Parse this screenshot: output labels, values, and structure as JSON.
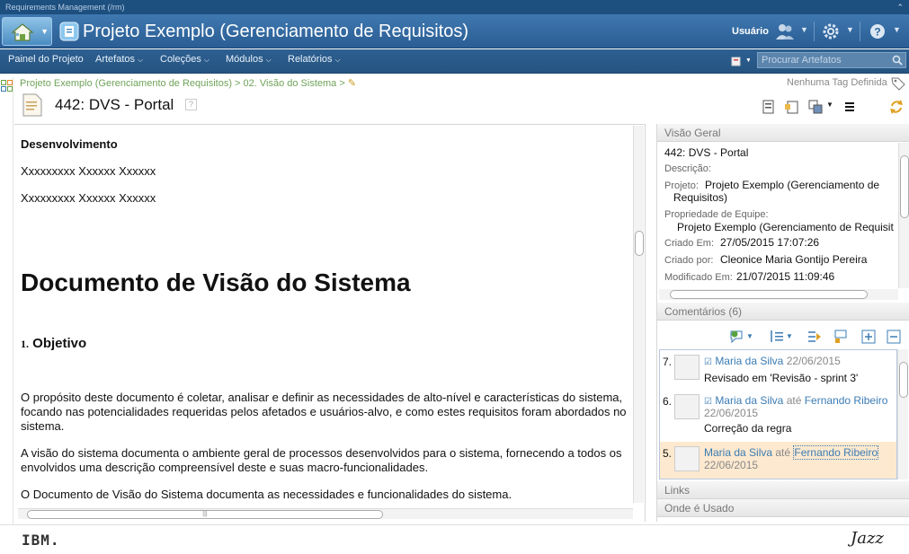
{
  "app": {
    "window_title": "Requirements Management (/rm)",
    "project_title": "Projeto Exemplo (Gerenciamento de Requisitos)",
    "user_label": "Usuário"
  },
  "nav": {
    "items": [
      "Painel do Projeto",
      "Artefatos",
      "Coleções",
      "Módulos",
      "Relatórios"
    ],
    "search_placeholder": "Procurar Artefatos"
  },
  "breadcrumb": {
    "path": "Projeto Exemplo (Gerenciamento de Requisitos) > 02. Visão do Sistema >",
    "tags": "Nenhuma Tag Definida"
  },
  "artifact": {
    "id": "442:",
    "name": "DVS - Portal",
    "help": "?"
  },
  "document": {
    "dev_heading": "Desenvolvimento",
    "line1": "Xxxxxxxxx Xxxxxx Xxxxxx",
    "line2": "Xxxxxxxxx Xxxxxx Xxxxxx",
    "title": "Documento de Visão do Sistema",
    "section_num": "1.",
    "section_title": "Objetivo",
    "para1a": "O propósito deste documento é coletar, analisar e definir as necessidades de alto-nível e características do sistema,",
    "para1b": "focando nas potencialidades requeridas pelos afetados e usuários-alvo, e como estes requisitos foram abordados no",
    "para1c": "sistema.",
    "para2a": "A visão do sistema documenta o ambiente geral de processos desenvolvidos para o sistema, fornecendo a todos os",
    "para2b": "envolvidos uma descrição compreensível deste e suas macro-funcionalidades.",
    "para3": "O Documento de Visão do Sistema documenta as necessidades e funcionalidades do sistema."
  },
  "overview": {
    "header": "Visão Geral",
    "title": "442: DVS - Portal",
    "desc_label": "Descrição:",
    "project_label": "Projeto:",
    "project_value_a": "Projeto Exemplo (Gerenciamento de",
    "project_value_b": "Requisitos)",
    "team_label": "Propriedade de Equipe:",
    "team_value": "Projeto Exemplo (Gerenciamento de Requisit",
    "created_label": "Criado Em:",
    "created_value": "27/05/2015 17:07:26",
    "creator_label": "Criado por:",
    "creator_value": "Cleonice Maria Gontijo Pereira",
    "modified_label": "Modificado Em:",
    "modified_value": "21/07/2015 11:09:46"
  },
  "comments": {
    "header": "Comentários (6)",
    "items": [
      {
        "num": "7.",
        "author": "Maria da Silva",
        "date": "22/06/2015",
        "to_word": "",
        "recipient": "",
        "text": "Revisado em 'Revisão - sprint 3'"
      },
      {
        "num": "6.",
        "author": "Maria da Silva",
        "date": "22/06/2015",
        "to_word": "até",
        "recipient": "Fernando Ribeiro",
        "text": "Correção da regra"
      },
      {
        "num": "5.",
        "author": "Maria da Silva",
        "date": "22/06/2015",
        "to_word": "até",
        "recipient": "Fernando Ribeiro",
        "text": ""
      }
    ]
  },
  "sections": {
    "links": "Links",
    "where_used": "Onde é Usado"
  },
  "footer": {
    "ibm": "IBM.",
    "jazz": "Jazz"
  }
}
